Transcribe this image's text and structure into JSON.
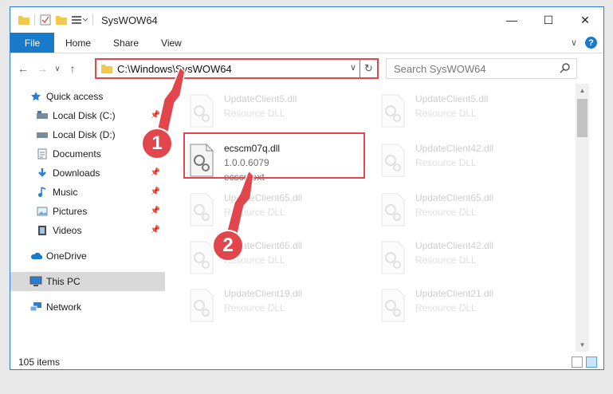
{
  "window": {
    "title": "SysWOW64",
    "controls": {
      "minimize": "—",
      "maximize": "☐",
      "close": "✕"
    }
  },
  "ribbon": {
    "file": "File",
    "tabs": [
      "Home",
      "Share",
      "View"
    ],
    "expand": "∨",
    "help": "?"
  },
  "nav": {
    "back": "←",
    "forward": "→",
    "recent": "∨",
    "up": "↑",
    "address": "C:\\Windows\\SysWOW64",
    "dropdown": "∨",
    "refresh": "↻",
    "search_placeholder": "Search SysWOW64"
  },
  "sidebar": {
    "items": [
      {
        "label": "Quick access",
        "icon": "star-icon",
        "pinned": false
      },
      {
        "label": "Local Disk (C:)",
        "icon": "drive-icon",
        "pinned": true
      },
      {
        "label": "Local Disk (D:)",
        "icon": "drive-icon",
        "pinned": false
      },
      {
        "label": "Documents",
        "icon": "documents-icon",
        "pinned": true
      },
      {
        "label": "Downloads",
        "icon": "downloads-icon",
        "pinned": true
      },
      {
        "label": "Music",
        "icon": "music-icon",
        "pinned": true
      },
      {
        "label": "Pictures",
        "icon": "pictures-icon",
        "pinned": true
      },
      {
        "label": "Videos",
        "icon": "videos-icon",
        "pinned": true
      },
      {
        "label": "OneDrive",
        "icon": "cloud-icon",
        "pinned": false
      },
      {
        "label": "This PC",
        "icon": "computer-icon",
        "pinned": false,
        "selected": true
      },
      {
        "label": "Network",
        "icon": "network-icon",
        "pinned": false
      }
    ],
    "pin_glyph": "📌"
  },
  "files": [
    {
      "name": "UpdateClient5.dll",
      "sub1": "Resource DLL",
      "sub2": "",
      "faded": true
    },
    {
      "name": "UpdateClient5.dll",
      "sub1": "Resource DLL",
      "sub2": "",
      "faded": true
    },
    {
      "name": "ecscm07q.dll",
      "sub1": "1.0.0.6079",
      "sub2": "ecscmext",
      "faded": false
    },
    {
      "name": "UpdateClient42.dll",
      "sub1": "Resource DLL",
      "sub2": "",
      "faded": true
    },
    {
      "name": "UpdateClient65.dll",
      "sub1": "Resource DLL",
      "sub2": "",
      "faded": true
    },
    {
      "name": "UpdateClient65.dll",
      "sub1": "Resource DLL",
      "sub2": "",
      "faded": true
    },
    {
      "name": "UpdateClient65.dll",
      "sub1": "Resource DLL",
      "sub2": "",
      "faded": true
    },
    {
      "name": "UpdateClient42.dll",
      "sub1": "Resource DLL",
      "sub2": "",
      "faded": true
    },
    {
      "name": "UpdateClient19.dll",
      "sub1": "Resource DLL",
      "sub2": "",
      "faded": true
    },
    {
      "name": "UpdateClient21.dll",
      "sub1": "Resource DLL",
      "sub2": "",
      "faded": true
    }
  ],
  "status": {
    "item_count": "105 items"
  },
  "callouts": [
    "1",
    "2"
  ],
  "colors": {
    "accent": "#1979ca",
    "highlight": "#e0464b",
    "selected": "#d9d9d9"
  }
}
